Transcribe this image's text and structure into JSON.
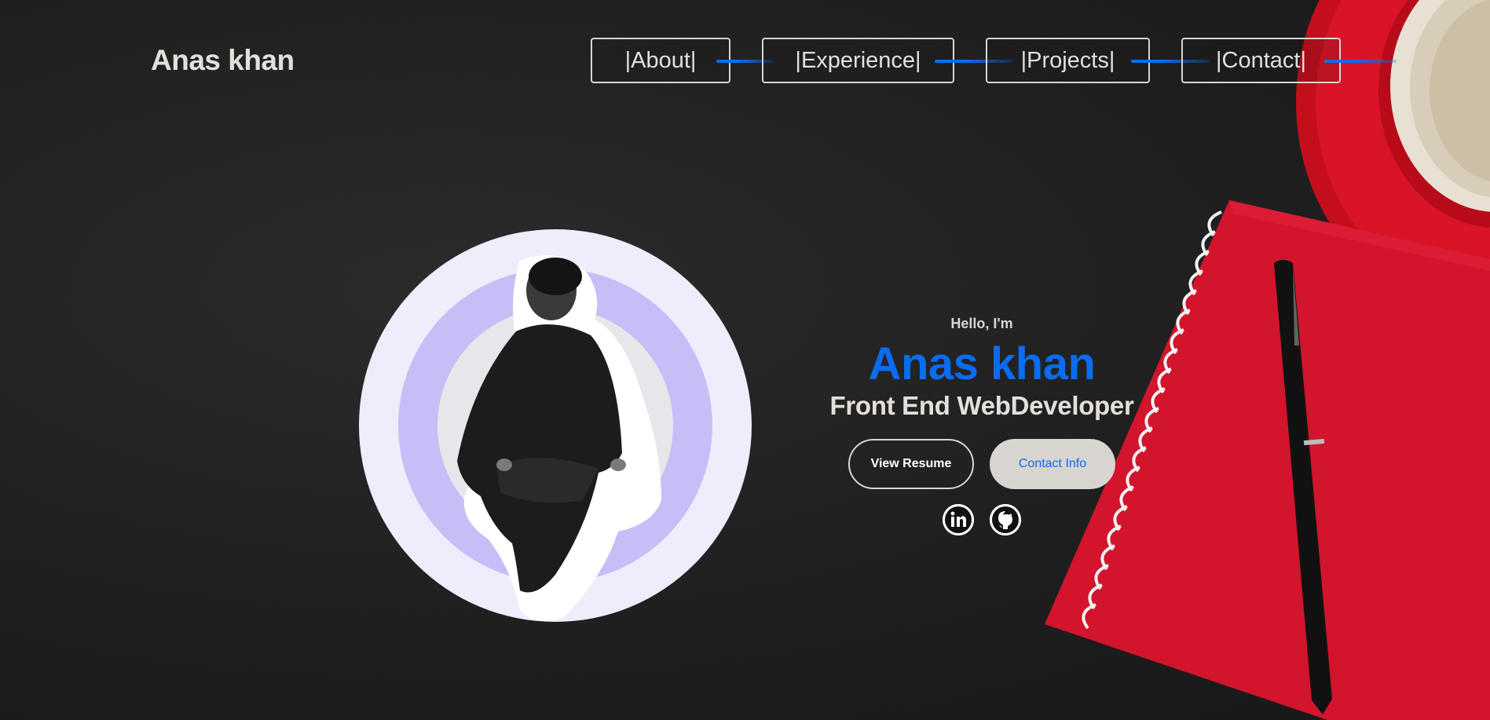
{
  "header": {
    "brand": "Anas khan",
    "nav": [
      {
        "label": "|About|"
      },
      {
        "label": "|Experience|"
      },
      {
        "label": "|Projects|"
      },
      {
        "label": "|Contact|"
      }
    ]
  },
  "hero": {
    "greeting": "Hello, I'm",
    "name": "Anas khan",
    "role": "Front End WebDeveloper",
    "buttons": {
      "resume": "View Resume",
      "contact": "Contact Info"
    },
    "social": [
      {
        "icon": "linkedin-icon"
      },
      {
        "icon": "github-icon"
      }
    ]
  },
  "colors": {
    "accent": "#0a6cf0",
    "text": "#e3e0dc",
    "background": "#1f1f1f",
    "notebook": "#d0112b",
    "avatar_ring": "#c9bdf7",
    "avatar_bg": "#efedfb"
  }
}
